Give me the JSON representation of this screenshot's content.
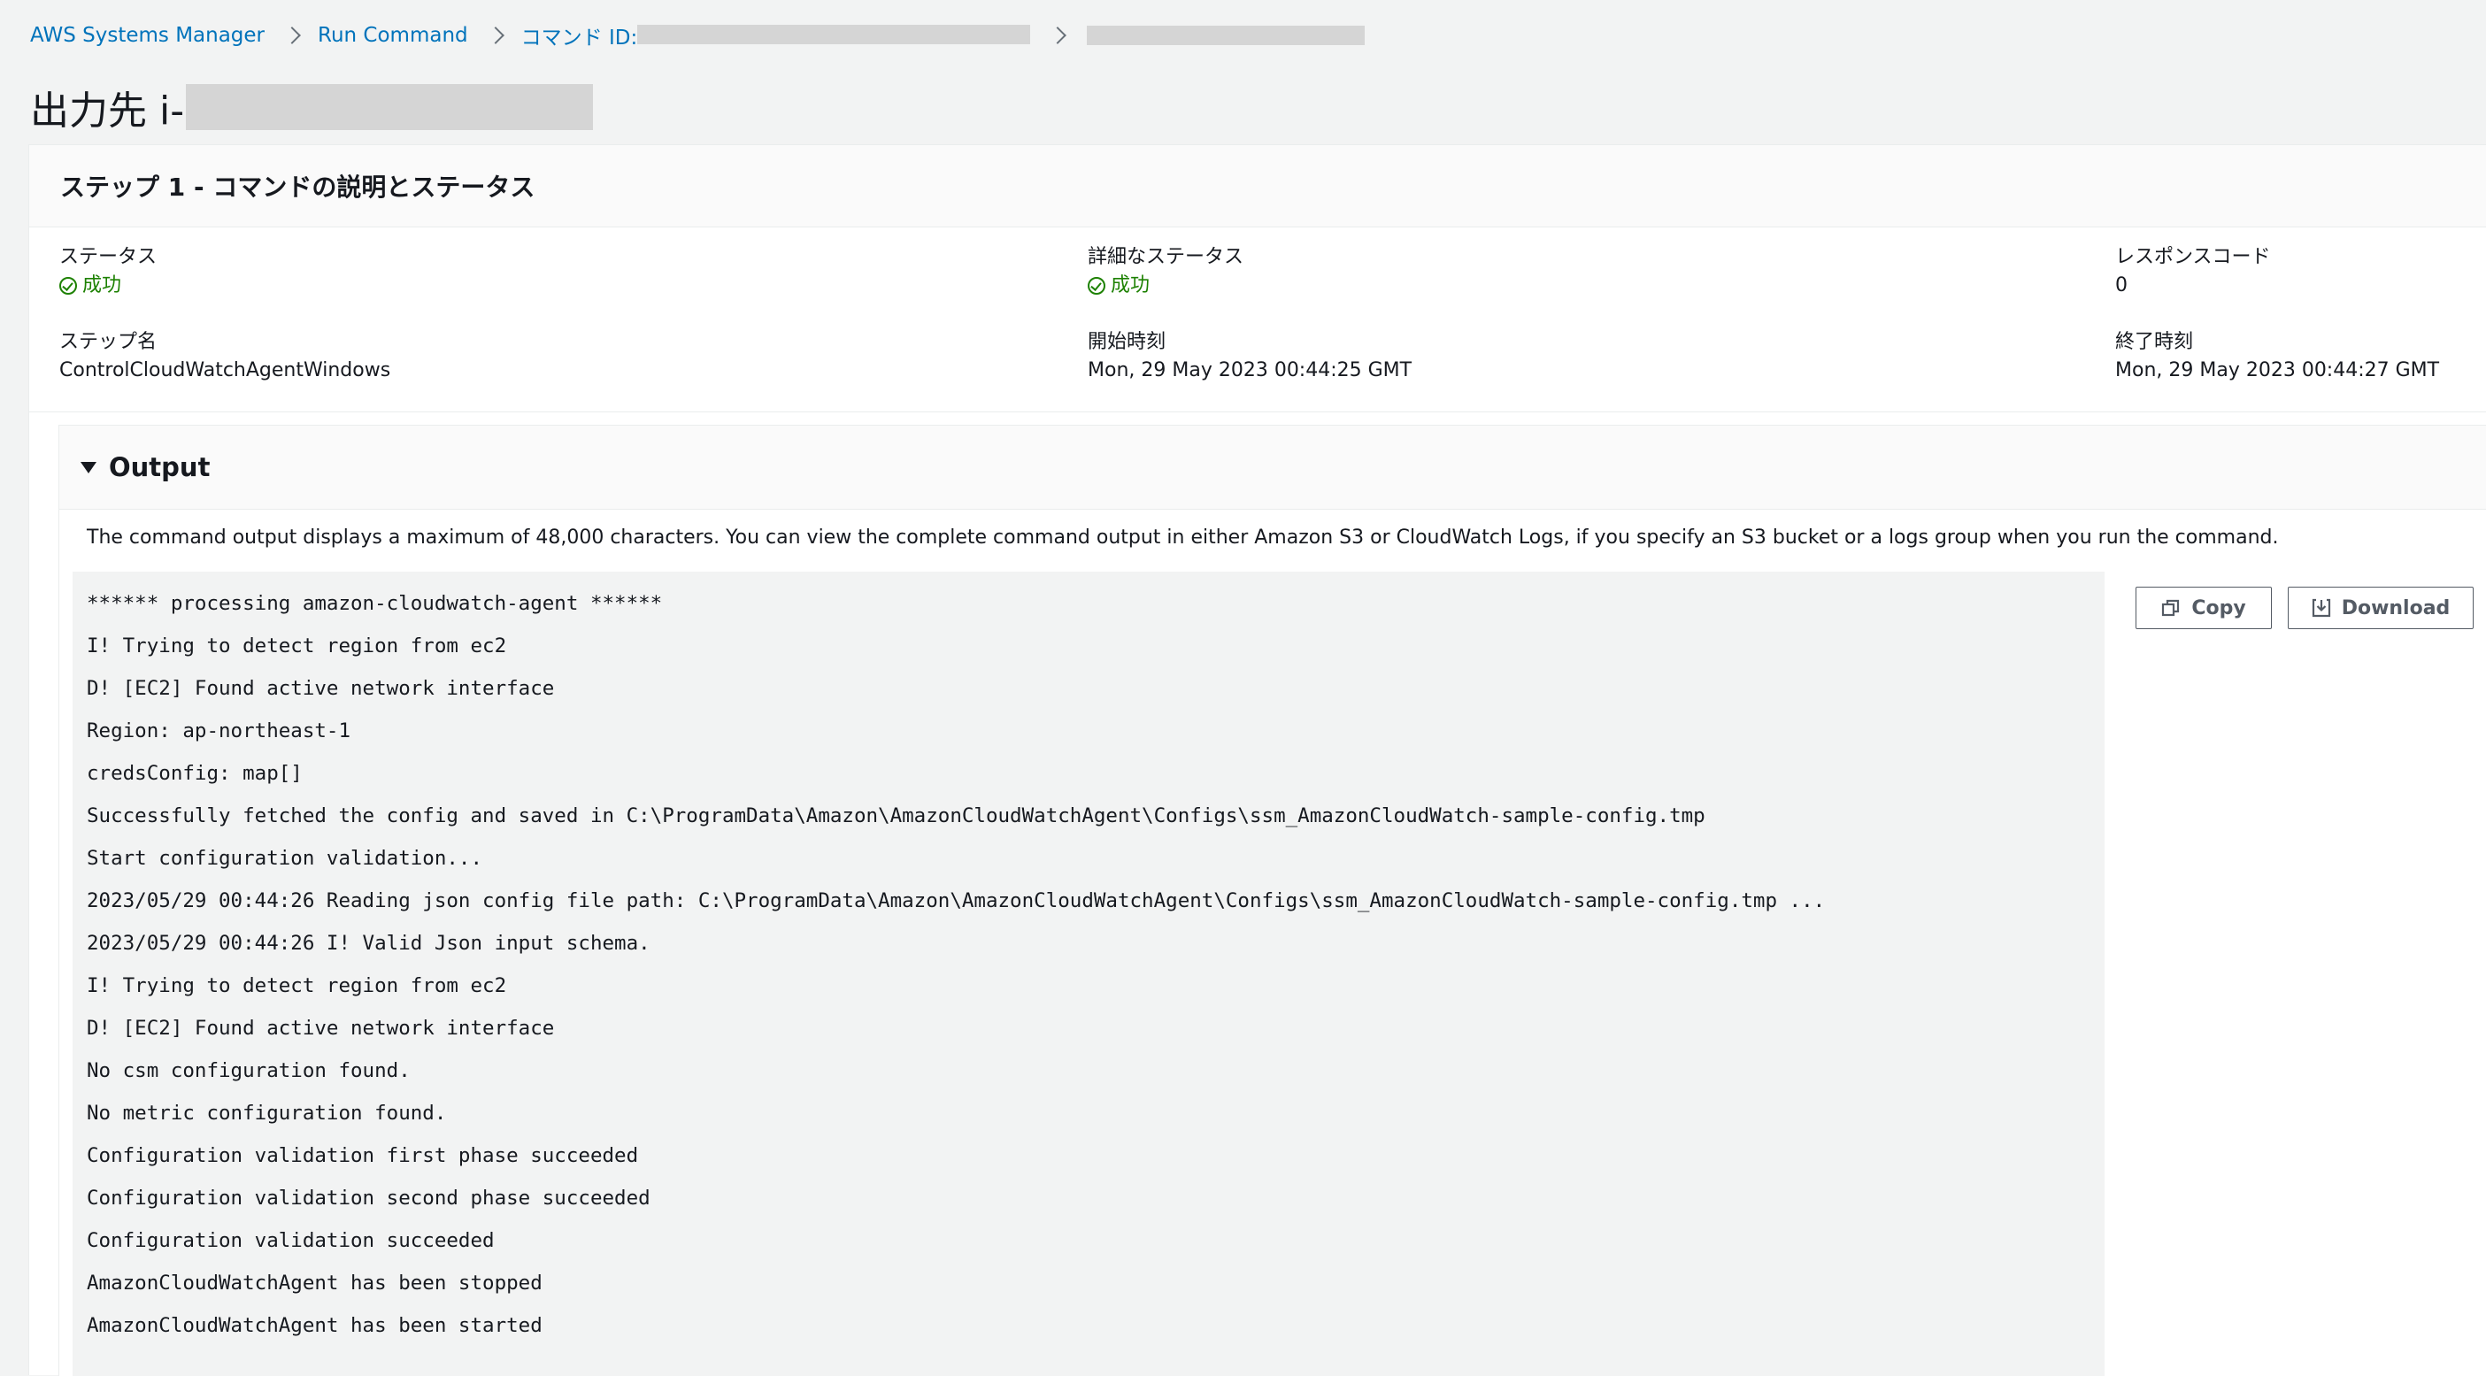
{
  "breadcrumb": {
    "items": [
      "AWS Systems Manager",
      "Run Command",
      "コマンド ID:"
    ]
  },
  "page": {
    "title": "出力先 i-"
  },
  "step": {
    "header": "ステップ 1 - コマンドの説明とステータス",
    "status_label": "ステータス",
    "status_value": "成功",
    "detail_status_label": "詳細なステータス",
    "detail_status_value": "成功",
    "response_code_label": "レスポンスコード",
    "response_code_value": "0",
    "step_name_label": "ステップ名",
    "step_name_value": "ControlCloudWatchAgentWindows",
    "start_time_label": "開始時刻",
    "start_time_value": "Mon, 29 May 2023 00:44:25 GMT",
    "end_time_label": "終了時刻",
    "end_time_value": "Mon, 29 May 2023 00:44:27 GMT"
  },
  "output": {
    "title": "Output",
    "note": "The command output displays a maximum of 48,000 characters. You can view the complete command output in either Amazon S3 or CloudWatch Logs, if you specify an S3 bucket or a logs group when you run the command.",
    "copy_label": "Copy",
    "download_label": "Download",
    "lines": [
      "****** processing amazon-cloudwatch-agent ******",
      "I! Trying to detect region from ec2",
      "D! [EC2] Found active network interface",
      "Region: ap-northeast-1",
      "credsConfig: map[]",
      "Successfully fetched the config and saved in C:\\ProgramData\\Amazon\\AmazonCloudWatchAgent\\Configs\\ssm_AmazonCloudWatch-sample-config.tmp",
      "Start configuration validation...",
      "2023/05/29 00:44:26 Reading json config file path: C:\\ProgramData\\Amazon\\AmazonCloudWatchAgent\\Configs\\ssm_AmazonCloudWatch-sample-config.tmp ...",
      "2023/05/29 00:44:26 I! Valid Json input schema.",
      "I! Trying to detect region from ec2",
      "D! [EC2] Found active network interface",
      "No csm configuration found.",
      "No metric configuration found.",
      "Configuration validation first phase succeeded",
      "Configuration validation second phase succeeded",
      "Configuration validation succeeded",
      "AmazonCloudWatchAgent has been stopped",
      "AmazonCloudWatchAgent has been started"
    ]
  },
  "colors": {
    "link": "#0073bb",
    "success": "#1d8102",
    "background": "#f2f3f3"
  }
}
